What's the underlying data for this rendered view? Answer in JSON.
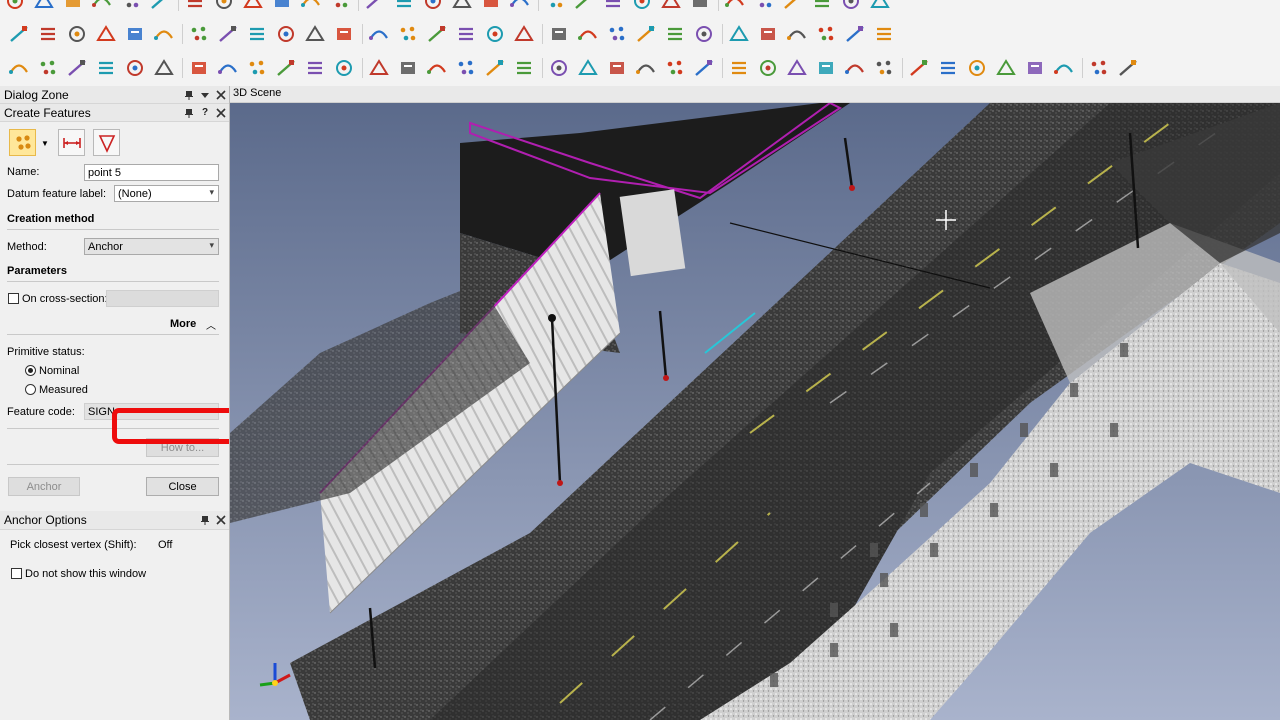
{
  "toolbar_rows": [
    [
      "file-new-icon",
      "open-icon",
      "save-icon",
      "undo-icon",
      "redo-icon",
      "camera-icon",
      "mesh-icon",
      "cut-icon",
      "bits-icon",
      "transform-icon",
      "table-icon",
      "cube-icon",
      "cloud-icon",
      "filter-icon",
      "scan-icon",
      "grid-icon",
      "folder-icon",
      "export-icon",
      "measure-icon",
      "network-icon",
      "print-icon",
      "settings-icon",
      "help-icon",
      "clip-icon",
      "boundary-icon",
      "fit-icon",
      "arrow-icon",
      "link-icon",
      "points-icon",
      "info-icon"
    ],
    [
      "registration-icon",
      "patch-icon",
      "contour-icon",
      "target-icon",
      "polyline-icon",
      "corner-icon",
      "plane-fit-icon",
      "extrude-icon",
      "trim-icon",
      "split-icon",
      "join-icon",
      "pipe-icon",
      "offset-icon",
      "section-icon",
      "probe-icon",
      "lamp-icon",
      "edit-icon",
      "shape-icon",
      "curve-icon",
      "texture-icon",
      "hatch-icon",
      "layer-icon",
      "clipboard-icon",
      "tag-icon",
      "scissor-icon",
      "ruler-icon",
      "pointer-icon",
      "stack-icon",
      "lock-icon",
      "target2-icon"
    ],
    [
      "select-points-icon",
      "move-icon",
      "spray-icon",
      "line-icon",
      "box-icon",
      "circle-icon",
      "arc-icon",
      "cylinder-icon",
      "rectangle-icon",
      "polygon-icon",
      "ellipse-icon",
      "tube-icon",
      "cone-icon",
      "sphere-icon",
      "torus-icon",
      "prism-icon",
      "node-icon",
      "cluster-icon",
      "dimension-icon",
      "triangle-icon",
      "scatter-icon",
      "pin-icon",
      "paint-icon",
      "binary-icon",
      "scan-cloud-icon",
      "segment-icon",
      "eraser-icon",
      "bend-icon",
      "fold-icon",
      "flip-icon",
      "check-icon",
      "bars-icon",
      "view-icon",
      "dashboard-icon",
      "align-icon",
      "list-icon",
      "stream-icon",
      "cube-view-icon"
    ]
  ],
  "dialog_zone": {
    "title": "Dialog Zone"
  },
  "create_features": {
    "title": "Create Features",
    "name_label": "Name:",
    "name_value": "point 5",
    "datum_label": "Datum feature label:",
    "datum_value": "(None)",
    "creation_method_heading": "Creation method",
    "method_label": "Method:",
    "method_value": "Anchor",
    "parameters_heading": "Parameters",
    "cross_section_label": "On cross-section:",
    "more_label": "More",
    "primitive_status_label": "Primitive status:",
    "nominal_label": "Nominal",
    "measured_label": "Measured",
    "feature_code_label": "Feature code:",
    "feature_code_value": "SIGN",
    "how_to_label": "How to...",
    "anchor_button": "Anchor",
    "close_button": "Close"
  },
  "anchor_options": {
    "title": "Anchor Options",
    "pick_vertex_label": "Pick closest vertex (Shift):",
    "pick_vertex_value": "Off",
    "dont_show_label": "Do not show this window"
  },
  "scene": {
    "title": "3D Scene"
  },
  "colors": {
    "highlight_box": "#ee0c0c",
    "active_tool": "#ffe79a",
    "sky": "#8a98b8"
  }
}
